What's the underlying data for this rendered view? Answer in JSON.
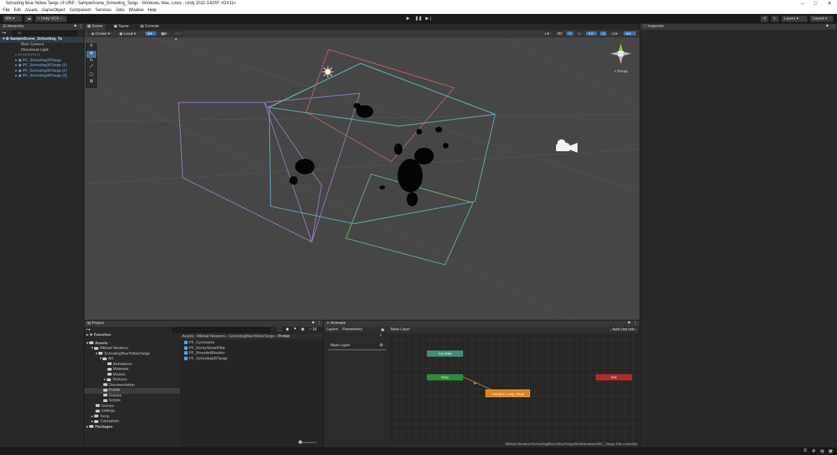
{
  "window": {
    "title": "Schooling Blue Yellow Tangs v3 URP - SampleScene_Schooling_Tangs - Windows, Mac, Linux - Unity 2022.3.62f3* <DX11>",
    "minimize": "–",
    "maximize": "□",
    "close": "✕"
  },
  "menu": [
    "File",
    "Edit",
    "Assets",
    "GameObject",
    "Component",
    "Services",
    "Jobs",
    "Window",
    "Help"
  ],
  "toolbar": {
    "account": "MN",
    "vcs": "Unity VCS",
    "layers": "Layers",
    "layout": "Layout"
  },
  "hierarchy": {
    "tab": "Hierarchy",
    "search_placeholder": "All",
    "scene": "SampleScene_Schooling_Ta",
    "items": [
      {
        "label": "Main Camera",
        "style": "normal"
      },
      {
        "label": "Directional Light",
        "style": "normal"
      },
      {
        "label": "Environment",
        "style": "gray"
      },
      {
        "label": "PF_Schooling30Tangs",
        "style": "blue"
      },
      {
        "label": "PF_Schooling30Tangs (1)",
        "style": "blue"
      },
      {
        "label": "PF_Schooling30Tangs (2)",
        "style": "blue"
      },
      {
        "label": "PF_Schooling30Tangs (3)",
        "style": "blue"
      }
    ]
  },
  "scene": {
    "tabs": [
      "Scene",
      "Game",
      "Console"
    ],
    "pivot": "Center",
    "space": "Local",
    "mode_2d": "2D",
    "persp": "< Persp"
  },
  "inspector": {
    "tab": "Inspector"
  },
  "project": {
    "tab": "Project",
    "count": "18",
    "favorites": "Favorites",
    "tree": [
      {
        "label": "Assets",
        "indent": 0,
        "bold": true
      },
      {
        "label": "Mikhail Nesterov",
        "indent": 1
      },
      {
        "label": "SchoolingBlueYellowTangs",
        "indent": 2
      },
      {
        "label": "Art",
        "indent": 3
      },
      {
        "label": "Animations",
        "indent": 4
      },
      {
        "label": "Materials",
        "indent": 4
      },
      {
        "label": "Models",
        "indent": 4
      },
      {
        "label": "Textures",
        "indent": 4
      },
      {
        "label": "Documentation",
        "indent": 3
      },
      {
        "label": "Prefab",
        "indent": 3,
        "selected": true
      },
      {
        "label": "Scenes",
        "indent": 3
      },
      {
        "label": "Scripts",
        "indent": 3
      },
      {
        "label": "Scenes",
        "indent": 2
      },
      {
        "label": "Settings",
        "indent": 2
      },
      {
        "label": "Temp",
        "indent": 2
      },
      {
        "label": "TutorialInfo",
        "indent": 2
      },
      {
        "label": "Packages",
        "indent": 0,
        "bold": true
      }
    ],
    "breadcrumb": [
      "Assets",
      "Mikhail Nesterov",
      "SchoolingBlueYellowTangs",
      "Prefab"
    ],
    "files": [
      "PF_Cyclorama",
      "PF_RockyStonePillar",
      "PF_RoundedBoulder",
      "PF_Schooling30Tangs"
    ]
  },
  "animator": {
    "tab": "Animator",
    "subtabs": [
      "Layers",
      "Parameters"
    ],
    "base_layer": "Base Layer",
    "auto_live_link": "Auto Live Link",
    "nodes": {
      "any_state": "Any State",
      "entry": "Entry",
      "exit": "Exit",
      "default": "Animation_Loop_Tangs"
    },
    "path": "Mikhail Nesterov/SchoolingBlueYellowTangs/Art/Animations/AC_Tangs Fish.controller"
  },
  "colors": {
    "any_state": "#3d8f7a",
    "entry": "#2f8a3a",
    "exit": "#b02b2b",
    "default_state": "#d9821f"
  }
}
